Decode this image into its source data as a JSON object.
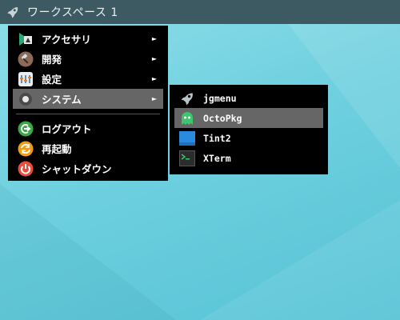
{
  "taskbar": {
    "workspace_label": "ワークスペース 1",
    "launcher_icon": "rocket-icon"
  },
  "main_menu": {
    "items": [
      {
        "label": "アクセサリ",
        "icon": "accessories-icon",
        "has_submenu": true
      },
      {
        "label": "開発",
        "icon": "development-hammer-icon",
        "has_submenu": true
      },
      {
        "label": "設定",
        "icon": "settings-icon",
        "has_submenu": true
      },
      {
        "label": "システム",
        "icon": "system-icon",
        "has_submenu": true,
        "selected": true
      }
    ],
    "actions": [
      {
        "label": "ログアウト",
        "icon": "logout-icon"
      },
      {
        "label": "再起動",
        "icon": "reboot-icon"
      },
      {
        "label": "シャットダウン",
        "icon": "power-icon"
      }
    ],
    "submenu_arrow": "►"
  },
  "system_submenu": {
    "items": [
      {
        "label": "jgmenu",
        "icon": "rocket-icon"
      },
      {
        "label": "OctoPkg",
        "icon": "octopkg-ghost-icon",
        "selected": true
      },
      {
        "label": "Tint2",
        "icon": "tint2-panel-icon"
      },
      {
        "label": "XTerm",
        "icon": "terminal-icon"
      }
    ]
  },
  "colors": {
    "menu_bg": "#000000",
    "selected_bg": "#666666",
    "taskbar_bg": "#3d5a62",
    "desktop_bg": "#6fd0df"
  }
}
